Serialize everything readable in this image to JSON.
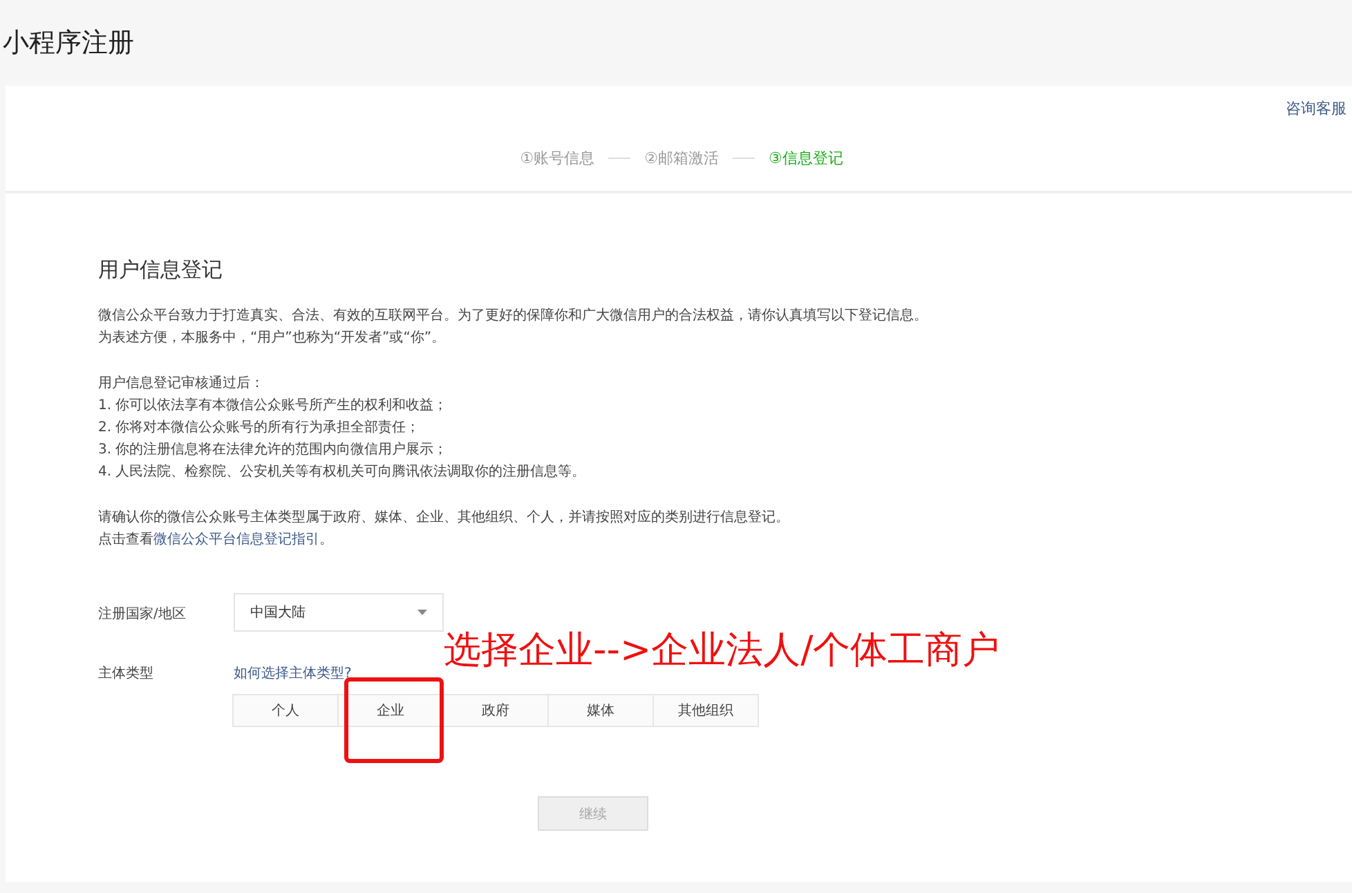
{
  "page_title": "小程序注册",
  "help_link": "咨询客服",
  "steps": [
    {
      "number": "①",
      "label": "账号信息",
      "selected": false
    },
    {
      "number": "②",
      "label": "邮箱激活",
      "selected": false
    },
    {
      "number": "③",
      "label": "信息登记",
      "selected": true
    }
  ],
  "section_title": "用户信息登记",
  "intro": [
    "微信公众平台致力于打造真实、合法、有效的互联网平台。为了更好的保障你和广大微信用户的合法权益，请你认真填写以下登记信息。",
    "为表述方便，本服务中，“用户”也称为“开发者”或“你”。"
  ],
  "after_review": [
    "用户信息登记审核通过后：",
    "1. 你可以依法享有本微信公众账号所产生的权利和收益；",
    "2. 你将对本微信公众账号的所有行为承担全部责任；",
    "3. 你的注册信息将在法律允许的范围内向微信用户展示；",
    "4. 人民法院、检察院、公安机关等有权机关可向腾讯依法调取你的注册信息等。"
  ],
  "confirm_text": "请确认你的微信公众账号主体类型属于政府、媒体、企业、其他组织、个人，并请按照对应的类别进行信息登记。",
  "guide": {
    "prefix": "点击查看",
    "link": "微信公众平台信息登记指引",
    "suffix": "。"
  },
  "region": {
    "label": "注册国家/地区",
    "value": "中国大陆"
  },
  "entity_type": {
    "label": "主体类型",
    "help_link": "如何选择主体类型?",
    "options": [
      {
        "label": "个人",
        "highlighted": false
      },
      {
        "label": "企业",
        "highlighted": true
      },
      {
        "label": "政府",
        "highlighted": false
      },
      {
        "label": "媒体",
        "highlighted": false
      },
      {
        "label": "其他组织",
        "highlighted": false
      }
    ]
  },
  "annotation": {
    "text": "选择企业-->企业法人/个体工商户"
  },
  "continue_button": {
    "label": "继续",
    "disabled": true
  }
}
